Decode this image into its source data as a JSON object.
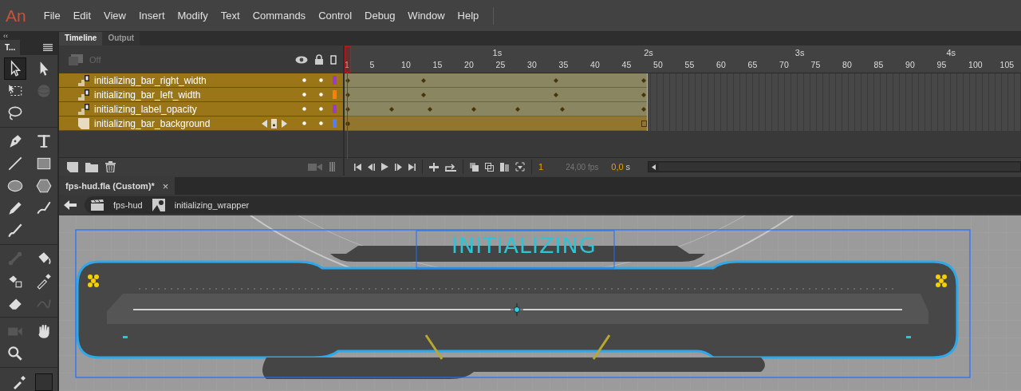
{
  "app_logo": "An",
  "menu": [
    "File",
    "Edit",
    "View",
    "Insert",
    "Modify",
    "Text",
    "Commands",
    "Control",
    "Debug",
    "Window",
    "Help"
  ],
  "tools_panel": {
    "collapse": "‹‹",
    "title": "T...",
    "groups": [
      [
        {
          "kind": "selection",
          "selected": true,
          "disabled": false
        },
        {
          "kind": "subselection",
          "selected": false,
          "disabled": false
        },
        {
          "kind": "free-transform",
          "selected": false,
          "disabled": false
        },
        {
          "kind": "rotation",
          "selected": false,
          "disabled": true
        },
        {
          "kind": "lasso",
          "selected": false,
          "disabled": false
        }
      ],
      [
        {
          "kind": "pen",
          "selected": false,
          "disabled": false
        },
        {
          "kind": "text",
          "selected": false,
          "disabled": false
        },
        {
          "kind": "line",
          "selected": false,
          "disabled": false
        },
        {
          "kind": "rectangle",
          "selected": false,
          "disabled": false
        },
        {
          "kind": "oval",
          "selected": false,
          "disabled": false
        },
        {
          "kind": "polystar",
          "selected": false,
          "disabled": false
        },
        {
          "kind": "pencil",
          "selected": false,
          "disabled": false
        },
        {
          "kind": "paint-brush",
          "selected": false,
          "disabled": false
        },
        {
          "kind": "brush",
          "selected": false,
          "disabled": false
        }
      ],
      [
        {
          "kind": "bone",
          "selected": false,
          "disabled": true
        },
        {
          "kind": "paint-bucket",
          "selected": false,
          "disabled": false
        },
        {
          "kind": "ink-bottle",
          "selected": false,
          "disabled": false
        },
        {
          "kind": "eyedropper",
          "selected": false,
          "disabled": false
        },
        {
          "kind": "eraser",
          "selected": false,
          "disabled": false
        },
        {
          "kind": "width",
          "selected": false,
          "disabled": true
        }
      ],
      [
        {
          "kind": "camera",
          "selected": false,
          "disabled": true
        },
        {
          "kind": "hand",
          "selected": false,
          "disabled": false
        },
        {
          "kind": "zoom",
          "selected": false,
          "disabled": false
        }
      ]
    ]
  },
  "timeline": {
    "tabs": [
      {
        "label": "Timeline",
        "selected": true
      },
      {
        "label": "Output",
        "selected": false
      }
    ],
    "layer_depth": "Off",
    "seconds": [
      "1s",
      "2s",
      "3s",
      "4s"
    ],
    "frame_numbers": [
      "1",
      "5",
      "10",
      "15",
      "20",
      "25",
      "30",
      "35",
      "40",
      "45",
      "50",
      "55",
      "60",
      "65",
      "70",
      "75",
      "80",
      "85",
      "90",
      "95",
      "100",
      "105"
    ],
    "layers": [
      {
        "name": "initializing_bar_right_width",
        "kind": "tween",
        "color": "#9b3ad6",
        "keyframe_nav": false
      },
      {
        "name": "initializing_bar_left_width",
        "kind": "tween",
        "color": "#ff8000",
        "keyframe_nav": false
      },
      {
        "name": "initializing_label_opacity",
        "kind": "tween",
        "color": "#9b3ad6",
        "keyframe_nav": false
      },
      {
        "name": "initializing_bar_background",
        "kind": "static",
        "color": "#4f7fff",
        "keyframe_nav": true
      }
    ],
    "current_frame": "1",
    "fps": "24,00 fps",
    "time": "0,0",
    "time_unit": "s"
  },
  "document": {
    "tab": "fps-hud.fla (Custom)*",
    "close": "×",
    "breadcrumb": [
      "fps-hud",
      "initializing_wrapper"
    ]
  },
  "stage": {
    "label_text": "INITIALIZING"
  }
}
